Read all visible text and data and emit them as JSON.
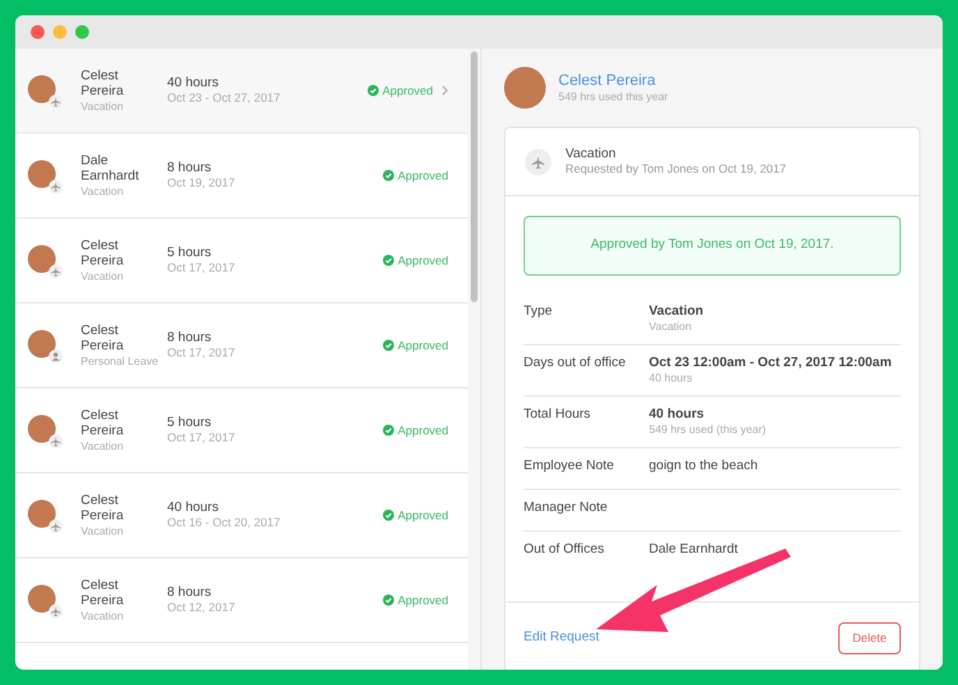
{
  "requests": [
    {
      "name": "Celest Pereira",
      "type": "Vacation",
      "kind": "vacation",
      "hours": "40 hours",
      "dates": "Oct 23 - Oct 27, 2017",
      "status": "Approved",
      "selected": true
    },
    {
      "name": "Dale Earnhardt",
      "type": "Vacation",
      "kind": "vacation",
      "hours": "8 hours",
      "dates": "Oct 19, 2017",
      "status": "Approved",
      "selected": false
    },
    {
      "name": "Celest Pereira",
      "type": "Vacation",
      "kind": "vacation",
      "hours": "5 hours",
      "dates": "Oct 17, 2017",
      "status": "Approved",
      "selected": false
    },
    {
      "name": "Celest Pereira",
      "type": "Personal Leave",
      "kind": "personal",
      "hours": "8 hours",
      "dates": "Oct 17, 2017",
      "status": "Approved",
      "selected": false
    },
    {
      "name": "Celest Pereira",
      "type": "Vacation",
      "kind": "vacation",
      "hours": "5 hours",
      "dates": "Oct 17, 2017",
      "status": "Approved",
      "selected": false
    },
    {
      "name": "Celest Pereira",
      "type": "Vacation",
      "kind": "vacation",
      "hours": "40 hours",
      "dates": "Oct 16 - Oct 20, 2017",
      "status": "Approved",
      "selected": false
    },
    {
      "name": "Celest Pereira",
      "type": "Vacation",
      "kind": "vacation",
      "hours": "8 hours",
      "dates": "Oct 12, 2017",
      "status": "Approved",
      "selected": false
    }
  ],
  "detail": {
    "employee": "Celest Pereira",
    "usage": "549 hrs used this year",
    "request_type": "Vacation",
    "requested_by": "Requested by Tom Jones on Oct 19, 2017",
    "approval": "Approved by Tom Jones on Oct 19, 2017.",
    "fields": [
      {
        "label": "Type",
        "value": "Vacation",
        "note": "Vacation"
      },
      {
        "label": "Days out of office",
        "value": "Oct 23 12:00am - Oct 27, 2017 12:00am",
        "note": "40 hours"
      },
      {
        "label": "Total Hours",
        "value": "40 hours",
        "note": "549 hrs used (this year)"
      },
      {
        "label": "Employee Note",
        "value": "goign to the beach"
      },
      {
        "label": "Manager Note"
      },
      {
        "label": "Out of Offices",
        "value": "Dale Earnhardt"
      }
    ],
    "edit_link": "Edit Request",
    "delete_button": "Delete"
  }
}
